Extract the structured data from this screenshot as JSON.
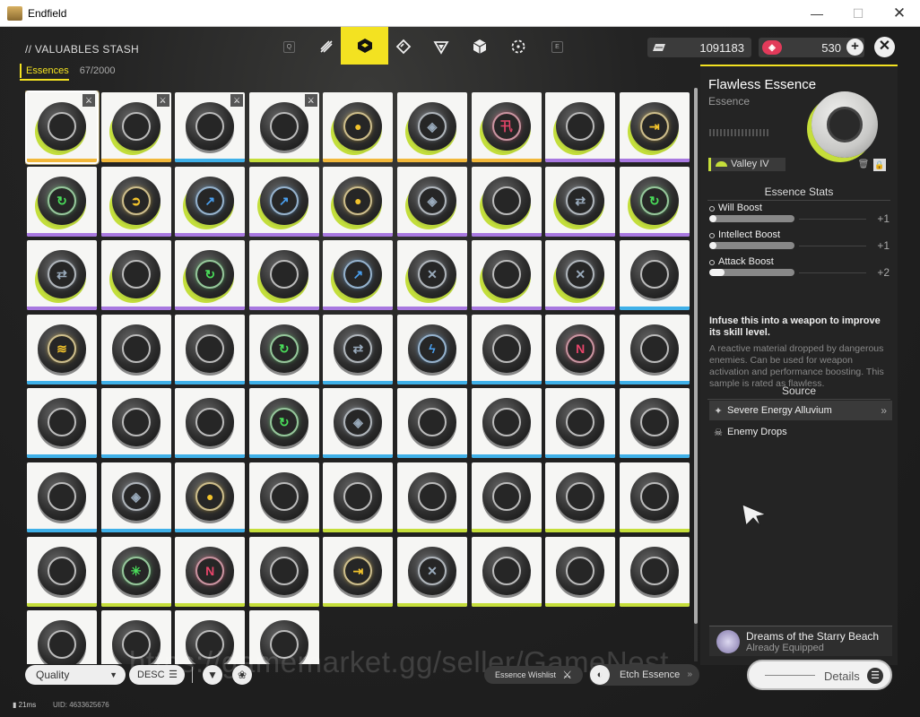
{
  "window": {
    "title": "Endfield",
    "minimize": "—",
    "maximize": "☐",
    "close": "✕"
  },
  "header": {
    "title": "// VALUABLES STASH",
    "key_left": "Q",
    "key_right": "E",
    "currency1": {
      "icon": "gold-bar-icon",
      "value": "1091183"
    },
    "currency2": {
      "icon": "originium-icon",
      "value": "530"
    },
    "plus": "+",
    "close": "✕"
  },
  "tab": {
    "label": "Essences",
    "count": "67/2000"
  },
  "colors": {
    "accent": "#f3e221",
    "lime": "#c5de3a",
    "gold": "#f2b83a",
    "purple": "#a878e0",
    "blue": "#3fb0e8"
  },
  "essences": [
    {
      "color": "lime",
      "stripe": "gold",
      "sym": "",
      "symColor": "",
      "mark": true,
      "selected": true
    },
    {
      "color": "lime",
      "stripe": "gold",
      "sym": "",
      "symColor": "",
      "mark": true
    },
    {
      "color": "grey",
      "stripe": "blue",
      "sym": "",
      "symColor": "",
      "mark": true
    },
    {
      "color": "grey",
      "stripe": "lime",
      "sym": "",
      "symColor": "",
      "mark": true
    },
    {
      "color": "lime",
      "stripe": "gold",
      "sym": "●",
      "symColor": "#f2c32c"
    },
    {
      "color": "lime",
      "stripe": "gold",
      "sym": "◈",
      "symColor": "#9ab"
    },
    {
      "color": "lime",
      "stripe": "gold",
      "sym": "卂",
      "symColor": "#e8456a"
    },
    {
      "color": "lime",
      "stripe": "purple",
      "sym": "",
      "symColor": ""
    },
    {
      "color": "lime",
      "stripe": "purple",
      "sym": "⇥",
      "symColor": "#f2c32c"
    },
    {
      "color": "lime",
      "stripe": "purple",
      "sym": "↻",
      "symColor": "#4ade5a"
    },
    {
      "color": "lime",
      "stripe": "purple",
      "sym": "➲",
      "symColor": "#f2c32c"
    },
    {
      "color": "lime",
      "stripe": "purple",
      "sym": "↗",
      "symColor": "#4aa0f0"
    },
    {
      "color": "lime",
      "stripe": "purple",
      "sym": "↗",
      "symColor": "#4aa0f0"
    },
    {
      "color": "lime",
      "stripe": "purple",
      "sym": "●",
      "symColor": "#f2c32c"
    },
    {
      "color": "lime",
      "stripe": "purple",
      "sym": "◈",
      "symColor": "#9ab"
    },
    {
      "color": "lime",
      "stripe": "purple",
      "sym": "",
      "symColor": ""
    },
    {
      "color": "lime",
      "stripe": "purple",
      "sym": "⇄",
      "symColor": "#9ab"
    },
    {
      "color": "lime",
      "stripe": "purple",
      "sym": "↻",
      "symColor": "#4ade5a"
    },
    {
      "color": "lime",
      "stripe": "purple",
      "sym": "⇄",
      "symColor": "#9ab"
    },
    {
      "color": "lime",
      "stripe": "purple",
      "sym": "",
      "symColor": ""
    },
    {
      "color": "lime",
      "stripe": "purple",
      "sym": "↻",
      "symColor": "#4ade5a"
    },
    {
      "color": "lime",
      "stripe": "purple",
      "sym": "",
      "symColor": ""
    },
    {
      "color": "lime",
      "stripe": "purple",
      "sym": "↗",
      "symColor": "#4aa0f0"
    },
    {
      "color": "lime",
      "stripe": "purple",
      "sym": "✕",
      "symColor": "#9ab"
    },
    {
      "color": "lime",
      "stripe": "purple",
      "sym": "",
      "symColor": ""
    },
    {
      "color": "lime",
      "stripe": "purple",
      "sym": "✕",
      "symColor": "#9ab"
    },
    {
      "color": "grey",
      "stripe": "blue",
      "sym": "",
      "symColor": ""
    },
    {
      "color": "grey",
      "stripe": "blue",
      "sym": "≋",
      "symColor": "#f2c32c"
    },
    {
      "color": "grey",
      "stripe": "blue",
      "sym": "",
      "symColor": ""
    },
    {
      "color": "grey",
      "stripe": "blue",
      "sym": "",
      "symColor": ""
    },
    {
      "color": "grey",
      "stripe": "blue",
      "sym": "↻",
      "symColor": "#4ade5a"
    },
    {
      "color": "grey",
      "stripe": "blue",
      "sym": "⇄",
      "symColor": "#9ab"
    },
    {
      "color": "grey",
      "stripe": "blue",
      "sym": "ϟ",
      "symColor": "#4aa0f0"
    },
    {
      "color": "grey",
      "stripe": "blue",
      "sym": "",
      "symColor": ""
    },
    {
      "color": "grey",
      "stripe": "blue",
      "sym": "N",
      "symColor": "#e8456a"
    },
    {
      "color": "grey",
      "stripe": "blue",
      "sym": "",
      "symColor": ""
    },
    {
      "color": "grey",
      "stripe": "blue",
      "sym": "",
      "symColor": ""
    },
    {
      "color": "grey",
      "stripe": "blue",
      "sym": "",
      "symColor": ""
    },
    {
      "color": "grey",
      "stripe": "blue",
      "sym": "",
      "symColor": ""
    },
    {
      "color": "grey",
      "stripe": "blue",
      "sym": "↻",
      "symColor": "#4ade5a"
    },
    {
      "color": "grey",
      "stripe": "blue",
      "sym": "◈",
      "symColor": "#9ab"
    },
    {
      "color": "grey",
      "stripe": "blue",
      "sym": "",
      "symColor": ""
    },
    {
      "color": "grey",
      "stripe": "blue",
      "sym": "",
      "symColor": ""
    },
    {
      "color": "grey",
      "stripe": "blue",
      "sym": "",
      "symColor": ""
    },
    {
      "color": "grey",
      "stripe": "blue",
      "sym": "",
      "symColor": ""
    },
    {
      "color": "grey",
      "stripe": "blue",
      "sym": "",
      "symColor": ""
    },
    {
      "color": "grey",
      "stripe": "blue",
      "sym": "◈",
      "symColor": "#9ab"
    },
    {
      "color": "grey",
      "stripe": "blue",
      "sym": "●",
      "symColor": "#f2c32c"
    },
    {
      "color": "grey",
      "stripe": "lime",
      "sym": "",
      "symColor": ""
    },
    {
      "color": "grey",
      "stripe": "lime",
      "sym": "",
      "symColor": ""
    },
    {
      "color": "grey",
      "stripe": "lime",
      "sym": "",
      "symColor": ""
    },
    {
      "color": "grey",
      "stripe": "lime",
      "sym": "",
      "symColor": ""
    },
    {
      "color": "grey",
      "stripe": "lime",
      "sym": "",
      "symColor": ""
    },
    {
      "color": "grey",
      "stripe": "lime",
      "sym": "",
      "symColor": ""
    },
    {
      "color": "grey",
      "stripe": "lime",
      "sym": "",
      "symColor": ""
    },
    {
      "color": "grey",
      "stripe": "lime",
      "sym": "✳",
      "symColor": "#4ade5a"
    },
    {
      "color": "grey",
      "stripe": "lime",
      "sym": "N",
      "symColor": "#e8456a"
    },
    {
      "color": "grey",
      "stripe": "lime",
      "sym": "",
      "symColor": ""
    },
    {
      "color": "grey",
      "stripe": "lime",
      "sym": "⇥",
      "symColor": "#f2c32c"
    },
    {
      "color": "grey",
      "stripe": "lime",
      "sym": "✕",
      "symColor": "#9ab"
    },
    {
      "color": "grey",
      "stripe": "lime",
      "sym": "",
      "symColor": ""
    },
    {
      "color": "grey",
      "stripe": "lime",
      "sym": "",
      "symColor": ""
    },
    {
      "color": "grey",
      "stripe": "lime",
      "sym": "",
      "symColor": ""
    },
    {
      "color": "grey",
      "stripe": "none",
      "sym": "",
      "symColor": ""
    },
    {
      "color": "grey",
      "stripe": "none",
      "sym": "",
      "symColor": ""
    },
    {
      "color": "grey",
      "stripe": "none",
      "sym": "",
      "symColor": ""
    },
    {
      "color": "grey",
      "stripe": "none",
      "sym": "",
      "symColor": ""
    }
  ],
  "detail": {
    "name": "Flawless Essence",
    "type": "Essence",
    "level": "Valley IV",
    "stats_title": "Essence Stats",
    "stats": [
      {
        "name": "Will Boost",
        "value": "+1",
        "fill": 0.08
      },
      {
        "name": "Intellect Boost",
        "value": "+1",
        "fill": 0.08
      },
      {
        "name": "Attack Boost",
        "value": "+2",
        "fill": 0.18
      }
    ],
    "usage": "Infuse this into a weapon to improve its skill level.",
    "lore": "A reactive material dropped by dangerous enemies. Can be used for weapon activation and performance boosting. This sample is rated as flawless.",
    "source_title": "Source",
    "sources": [
      {
        "label": "Severe Energy Alluvium",
        "arrow": "»"
      },
      {
        "label": "Enemy Drops",
        "arrow": ""
      }
    ],
    "equipped": {
      "name": "Dreams of the Starry Beach",
      "status": "Already Equipped"
    }
  },
  "bottom": {
    "sort_label": "Quality",
    "order_label": "DESC",
    "wishlist_label": "Essence Wishlist",
    "etch_label": "Etch Essence",
    "details_label": "Details",
    "ping": "21ms",
    "uid": "UID: 4633625676",
    "watermark": "https://gamemarket.gg/seller/GameNest"
  }
}
